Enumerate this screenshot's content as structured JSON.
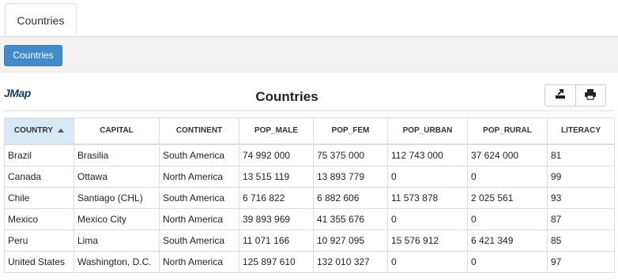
{
  "tabs": [
    {
      "label": "Countries"
    }
  ],
  "toolbar": {
    "countries_button": "Countries"
  },
  "report": {
    "logo": "JMap",
    "title": "Countries"
  },
  "actions": {
    "export_icon": "export-icon",
    "print_icon": "print-icon"
  },
  "table": {
    "sorted_column": "COUNTRY",
    "sort_direction": "ascending",
    "columns": [
      "COUNTRY",
      "CAPITAL",
      "CONTINENT",
      "POP_MALE",
      "POP_FEM",
      "POP_URBAN",
      "POP_RURAL",
      "LITERACY"
    ],
    "rows": [
      [
        "Brazil",
        "Brasilia",
        "South America",
        "74 992 000",
        "75 375 000",
        "112 743 000",
        "37 624 000",
        "81"
      ],
      [
        "Canada",
        "Ottawa",
        "North America",
        "13 515 119",
        "13 893 779",
        "0",
        "0",
        "99"
      ],
      [
        "Chile",
        "Santiago (CHL)",
        "South America",
        "6 716 822",
        "6 882 606",
        "11 573 878",
        "2 025 561",
        "93"
      ],
      [
        "Mexico",
        "Mexico City",
        "North America",
        "39 893 969",
        "41 355 676",
        "0",
        "0",
        "87"
      ],
      [
        "Peru",
        "Lima",
        "South America",
        "11 071 166",
        "10 927 095",
        "15 576 912",
        "6 421 349",
        "85"
      ],
      [
        "United States",
        "Washington, D.C.",
        "North America",
        "125 897 610",
        "132 010 327",
        "0",
        "0",
        "97"
      ]
    ]
  },
  "colors": {
    "primary": "#428bca",
    "sorted_header": "#d9e8f5",
    "toolbar_band": "#f2f2f2"
  }
}
